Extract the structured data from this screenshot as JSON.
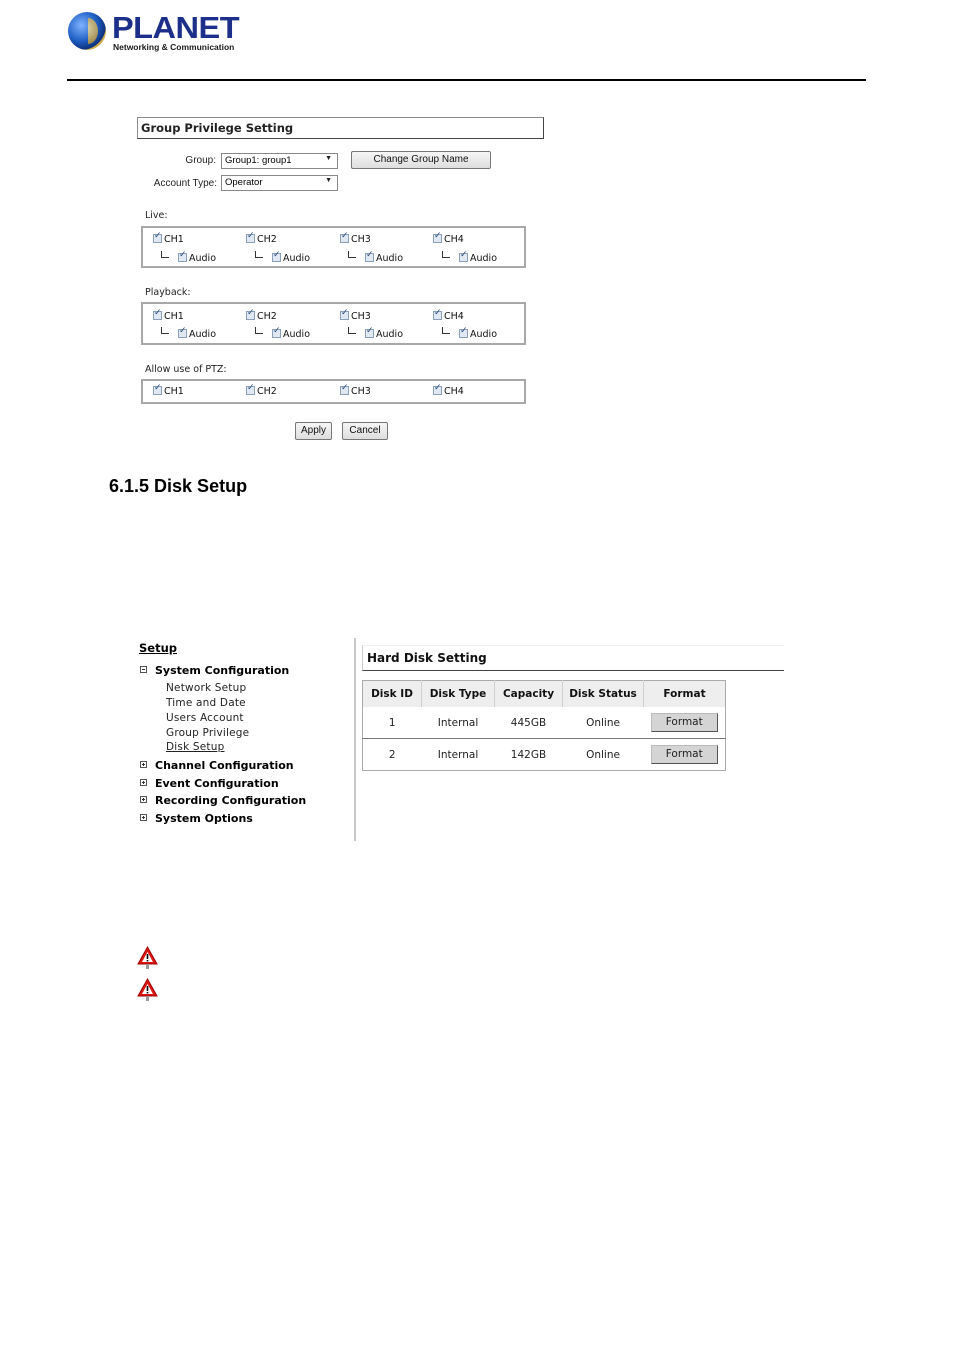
{
  "header": {
    "brand": "PLANET",
    "tagline": "Networking & Communication"
  },
  "group_privilege": {
    "title": "Group Privilege Setting",
    "group_label": "Group:",
    "group_value": "Group1: group1",
    "change_group_name_button": "Change Group Name",
    "account_type_label": "Account Type:",
    "account_type_value": "Operator",
    "live": {
      "label": "Live:",
      "channels": [
        {
          "name": "CH1",
          "checked": true,
          "audio_label": "Audio",
          "audio_checked": true
        },
        {
          "name": "CH2",
          "checked": true,
          "audio_label": "Audio",
          "audio_checked": true
        },
        {
          "name": "CH3",
          "checked": true,
          "audio_label": "Audio",
          "audio_checked": true
        },
        {
          "name": "CH4",
          "checked": true,
          "audio_label": "Audio",
          "audio_checked": true
        }
      ]
    },
    "playback": {
      "label": "Playback:",
      "channels": [
        {
          "name": "CH1",
          "checked": true,
          "audio_label": "Audio",
          "audio_checked": true
        },
        {
          "name": "CH2",
          "checked": true,
          "audio_label": "Audio",
          "audio_checked": true
        },
        {
          "name": "CH3",
          "checked": true,
          "audio_label": "Audio",
          "audio_checked": true
        },
        {
          "name": "CH4",
          "checked": true,
          "audio_label": "Audio",
          "audio_checked": true
        }
      ]
    },
    "ptz": {
      "label": "Allow use of PTZ:",
      "channels": [
        {
          "name": "CH1",
          "checked": true
        },
        {
          "name": "CH2",
          "checked": true
        },
        {
          "name": "CH3",
          "checked": true
        },
        {
          "name": "CH4",
          "checked": true
        }
      ]
    },
    "apply_button": "Apply",
    "cancel_button": "Cancel"
  },
  "section_heading": "6.1.5 Disk Setup",
  "setup_nav": {
    "title": "Setup",
    "categories": [
      {
        "label": "System Configuration",
        "expanded": true,
        "items": [
          "Network Setup",
          "Time and Date",
          "Users Account",
          "Group Privilege",
          "Disk Setup"
        ],
        "active_item": "Disk Setup"
      },
      {
        "label": "Channel Configuration",
        "expanded": false
      },
      {
        "label": "Event Configuration",
        "expanded": false
      },
      {
        "label": "Recording Configuration",
        "expanded": false
      },
      {
        "label": "System Options",
        "expanded": false
      }
    ]
  },
  "hard_disk": {
    "title": "Hard Disk Setting",
    "columns": [
      "Disk ID",
      "Disk Type",
      "Capacity",
      "Disk Status",
      "Format"
    ],
    "rows": [
      {
        "id": "1",
        "type": "Internal",
        "capacity": "445GB",
        "status": "Online",
        "action": "Format"
      },
      {
        "id": "2",
        "type": "Internal",
        "capacity": "142GB",
        "status": "Online",
        "action": "Format"
      }
    ]
  },
  "warnings": [
    {
      "icon": "warning-triangle-icon"
    },
    {
      "icon": "warning-triangle-icon"
    }
  ]
}
